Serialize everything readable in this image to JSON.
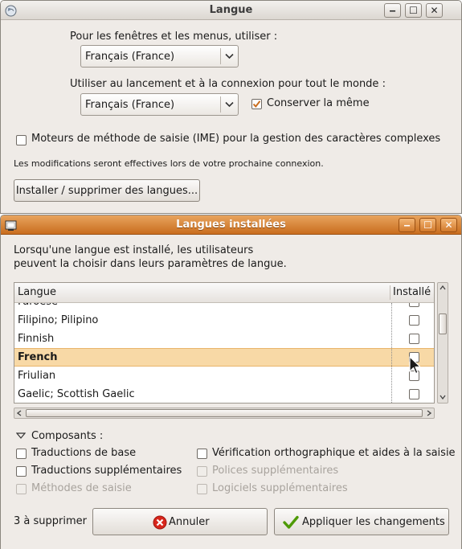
{
  "langue_window": {
    "title": "Langue",
    "menus_label": "Pour les fenêtres et les menus, utiliser :",
    "menus_value": "Français (France)",
    "startup_label": "Utiliser au lancement et à la connexion pour tout le monde :",
    "startup_value": "Français (France)",
    "keep_same_label": "Conserver la même",
    "keep_same_checked": true,
    "ime_label": "Moteurs de méthode de saisie (IME) pour la gestion des caractères complexes",
    "ime_checked": false,
    "notice": "Les modifications seront effectives lors de votre prochaine connexion.",
    "install_button": "Installer / supprimer des langues..."
  },
  "installed_window": {
    "title": "Langues installées",
    "description_line1": "Lorsqu'une langue est installé, les utilisateurs",
    "description_line2": "peuvent la choisir dans leurs paramètres de langue.",
    "table": {
      "columns": [
        "Langue",
        "Installé"
      ],
      "rows": [
        {
          "name": "Faroese",
          "installed": false,
          "selected": false
        },
        {
          "name": "Filipino; Pilipino",
          "installed": false,
          "selected": false
        },
        {
          "name": "Finnish",
          "installed": false,
          "selected": false
        },
        {
          "name": "French",
          "installed": false,
          "selected": true
        },
        {
          "name": "Friulian",
          "installed": false,
          "selected": false
        },
        {
          "name": "Gaelic; Scottish Gaelic",
          "installed": false,
          "selected": false
        }
      ]
    },
    "components": {
      "header": "Composants :",
      "items": [
        {
          "label": "Traductions de base",
          "enabled": true
        },
        {
          "label": "Vérification orthographique et aides à la saisie",
          "enabled": true
        },
        {
          "label": "Traductions supplémentaires",
          "enabled": true
        },
        {
          "label": "Polices supplémentaires",
          "enabled": false
        },
        {
          "label": "Méthodes de saisie",
          "enabled": false
        },
        {
          "label": "Logiciels supplémentaires",
          "enabled": false
        }
      ]
    },
    "remove_count": "3 à supprimer",
    "cancel_button": "Annuler",
    "apply_button": "Appliquer les changements"
  },
  "colors": {
    "active_titlebar": "#c96d1e",
    "selection": "#f8d9a6",
    "checkmark": "#c96d1e",
    "cancel_icon": "#d8261c",
    "apply_icon": "#4e9a06"
  },
  "icons": [
    "app-icon",
    "minimize-icon",
    "maximize-icon",
    "close-icon",
    "chevron-down-icon",
    "checkmark-icon",
    "expander-icon",
    "cancel-icon",
    "apply-icon",
    "mouse-cursor"
  ]
}
